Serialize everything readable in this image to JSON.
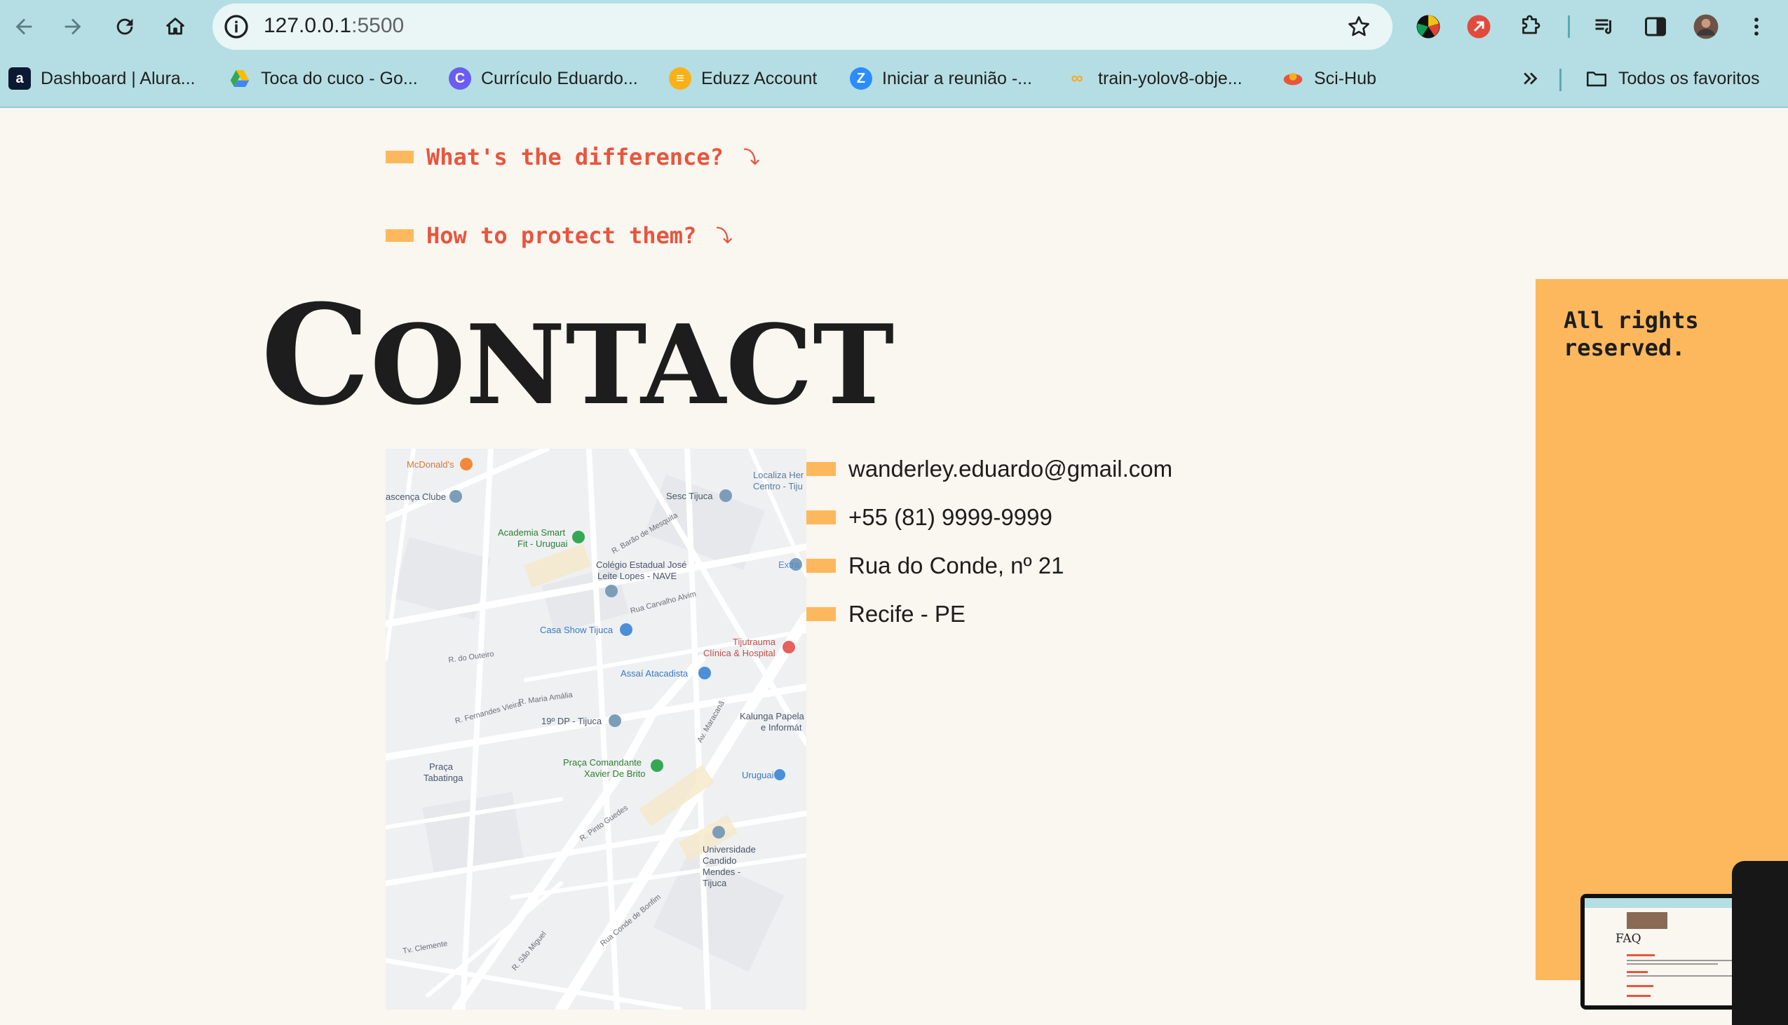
{
  "browser": {
    "url_host": "127.0.0.1",
    "url_port": ":5500",
    "bookmarks": [
      {
        "label": "Dashboard | Alura...",
        "icon": "alura-icon",
        "color": "#0b1a33"
      },
      {
        "label": "Toca do cuco - Go...",
        "icon": "google-drive-icon",
        "color": "#34a853"
      },
      {
        "label": "Currículo Eduardo...",
        "icon": "canva-icon",
        "color": "#6b5cf2"
      },
      {
        "label": "Eduzz Account",
        "icon": "eduzz-icon",
        "color": "#f9b11a"
      },
      {
        "label": "Iniciar a reunião -...",
        "icon": "zoom-icon",
        "color": "#2d8cff"
      },
      {
        "label": "train-yolov8-obje...",
        "icon": "colab-icon",
        "color": "#f9a825"
      },
      {
        "label": "Sci-Hub",
        "icon": "scihub-icon",
        "color": "#e8553e"
      }
    ],
    "all_bookmarks_label": "Todos os favoritos"
  },
  "page": {
    "faq_links": [
      {
        "label": "What's the difference?"
      },
      {
        "label": "How to protect them?"
      }
    ],
    "contact_title_initial": "C",
    "contact_title_rest": "ONTACT",
    "map_labels": {
      "mcdonalds": "McDonald's",
      "clube": "ascença Clube",
      "sesc": "Sesc Tijuca",
      "localiza": "Localiza Her",
      "localiza2": "Centro - Tiju",
      "academia1": "Academia Smart",
      "academia2": "Fit - Uruguai",
      "colegio1": "Colégio Estadual José",
      "colegio2": "Leite Lopes - NAVE",
      "extra": "Extra",
      "casa_show": "Casa Show Tijuca",
      "tijutrauma1": "Tijutrauma",
      "tijutrauma2": "Clínica & Hospital",
      "assai": "Assaí Atacadista",
      "dp": "19º DP - Tijuca",
      "kalunga1": "Kalunga Papela",
      "kalunga2": "e Informát",
      "praca_tab1": "Praça",
      "praca_tab2": "Tabatinga",
      "praca_cmd1": "Praça Comandante",
      "praca_cmd2": "Xavier De Brito",
      "uruguai": "Uruguai",
      "univ1": "Universidade",
      "univ2": "Candido",
      "univ3": "Mendes -",
      "univ4": "Tijuca",
      "r_pinto_guedes": "R. Pinto Guedes",
      "av_maracana": "Av. Maracanã",
      "rua_conde": "Rua Conde de Bonfim",
      "r_sao_miguel": "R. São Miguel",
      "r_maria_amalia": "R. Maria Amália",
      "r_fernandes": "R. Fernandes Vieira",
      "r_do_outeiro": "R. do Outeiro",
      "rua_carvalho": "Rua Carvalho Alvim",
      "r_barao": "R. Barão de Mesquita",
      "r_clemente": "Tv. Clemente"
    },
    "contact_items": [
      {
        "text": "wanderley.eduardo@gmail.com"
      },
      {
        "text": "+55 (81) 9999-9999"
      },
      {
        "text": "Rua do Conde, nº 21"
      },
      {
        "text": "Recife - PE"
      }
    ],
    "footer_text": "All rights reserved.",
    "thumbnail_title": "FAQ"
  },
  "colors": {
    "accent_orange": "#fdb85d",
    "link_red": "#e8553e",
    "background": "#faf6f0",
    "chrome": "#b4dee3"
  }
}
